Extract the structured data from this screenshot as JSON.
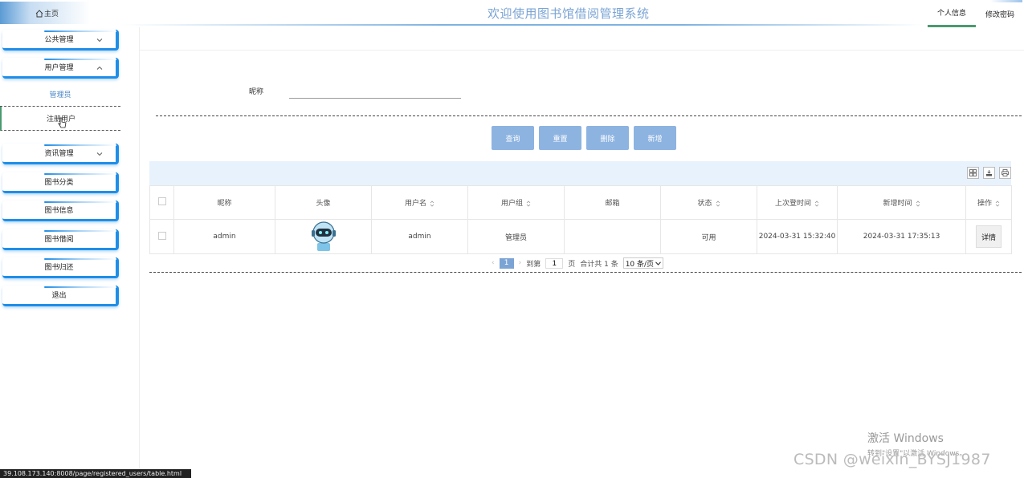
{
  "header": {
    "home_label": "主页",
    "title": "欢迎使用图书馆借阅管理系统",
    "right_links": [
      "个人信息",
      "修改密码"
    ]
  },
  "sidebar": {
    "menus": [
      {
        "label": "公共管理",
        "expandable": true,
        "expanded": false
      },
      {
        "label": "用户管理",
        "expandable": true,
        "expanded": true
      },
      {
        "label": "资讯管理",
        "expandable": true,
        "expanded": false
      },
      {
        "label": "图书分类"
      },
      {
        "label": "图书信息"
      },
      {
        "label": "图书借阅"
      },
      {
        "label": "图书归还"
      },
      {
        "label": "退出"
      }
    ],
    "submenu": [
      "管理员",
      "注册用户"
    ]
  },
  "search": {
    "label": "昵称",
    "value": ""
  },
  "buttons": [
    "查询",
    "重置",
    "删除",
    "新增"
  ],
  "table": {
    "columns": [
      "昵称",
      "头像",
      "用户名",
      "用户组",
      "邮箱",
      "状态",
      "上次登时间",
      "新增时间",
      "操作"
    ],
    "rows": [
      {
        "nickname": "admin",
        "username": "admin",
        "group": "管理员",
        "email": "",
        "status": "可用",
        "last_login": "2024-03-31 15:32:40",
        "created": "2024-03-31 17:35:13",
        "action": "详情"
      }
    ]
  },
  "pager": {
    "current_page": "1",
    "goto_label": "到第",
    "goto_value": "1",
    "page_unit": "页",
    "total_text": "合计共 1 条",
    "page_size": "10 条/页"
  },
  "statusbar": "39.108.173.140:8008/page/registered_users/table.html",
  "watermark": {
    "win_line1": "激活 Windows",
    "win_line2": "转到\"设置\"以激活 Windows。",
    "csdn": "CSDN @weixin_BYSJ1987"
  },
  "colors": {
    "accent": "#8db3e1",
    "title": "#7ba4d4",
    "menu_border": "#1f8ee8"
  }
}
